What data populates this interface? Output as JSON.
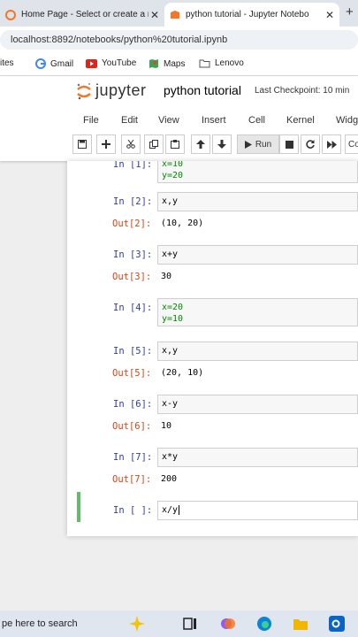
{
  "browser": {
    "tabs": [
      {
        "label": "Home Page - Select or create a ne"
      },
      {
        "label": "python tutorial - Jupyter Notebo"
      }
    ],
    "close_glyph": "✕",
    "new_tab_glyph": "+",
    "url": "localhost:8892/notebooks/python%20tutorial.ipynb",
    "bookmarks": [
      {
        "label": "ites",
        "icon": "folder-icon"
      },
      {
        "label": "Gmail",
        "icon": "google-icon"
      },
      {
        "label": "YouTube",
        "icon": "youtube-icon"
      },
      {
        "label": "Maps",
        "icon": "maps-icon"
      },
      {
        "label": "Lenovo",
        "icon": "folder-icon"
      }
    ]
  },
  "jupyter": {
    "logo_text": "jupyter",
    "notebook_title": "python tutorial",
    "checkpoint": "Last Checkpoint: 10 min",
    "menu": [
      "File",
      "Edit",
      "View",
      "Insert",
      "Cell",
      "Kernel",
      "Widg"
    ],
    "toolbar": {
      "run_label": "Run",
      "icons": [
        "save-icon",
        "add-cell-icon",
        "cut-icon",
        "copy-icon",
        "paste-icon",
        "move-up-icon",
        "move-down-icon",
        "run-icon",
        "stop-icon",
        "restart-icon",
        "fast-forward-icon"
      ],
      "cell_type": "Co"
    }
  },
  "cells": [
    {
      "in": "In [1]:",
      "code": [
        "x=10",
        "y=20"
      ],
      "out": null,
      "out_label": null
    },
    {
      "in": "In [2]:",
      "code": [
        "x,y"
      ],
      "out": "(10, 20)",
      "out_label": "Out[2]:"
    },
    {
      "in": "In [3]:",
      "code": [
        "x+y"
      ],
      "out": "30",
      "out_label": "Out[3]:"
    },
    {
      "in": "In [4]:",
      "code": [
        "x=20",
        "y=10"
      ],
      "out": null,
      "out_label": null
    },
    {
      "in": "In [5]:",
      "code": [
        "x,y"
      ],
      "out": "(20, 10)",
      "out_label": "Out[5]:"
    },
    {
      "in": "In [6]:",
      "code": [
        "x-y"
      ],
      "out": "10",
      "out_label": "Out[6]:"
    },
    {
      "in": "In [7]:",
      "code": [
        "x*y"
      ],
      "out": "200",
      "out_label": "Out[7]:"
    },
    {
      "in": "In [ ]:",
      "code": [
        "x/y"
      ],
      "out": null,
      "out_label": null
    }
  ],
  "taskbar": {
    "search_placeholder": "pe here to search"
  },
  "colors": {
    "prompt_in": "#303f9f",
    "prompt_out": "#d84315",
    "selected_cell": "#66bb6a",
    "jupyter_orange": "#f37726"
  }
}
